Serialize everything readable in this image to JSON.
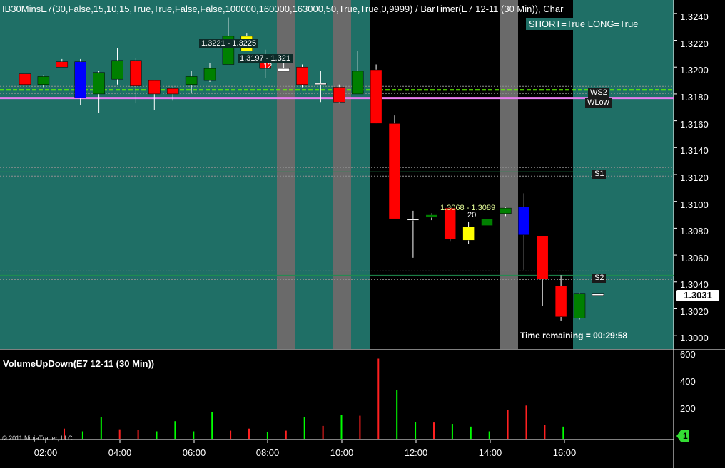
{
  "colors": {
    "chart_bg": "#1f6f66",
    "night_bg": "#000000",
    "session_bar": "#6a6a6a",
    "up": "#008000",
    "down": "#ff0000",
    "highlight_yellow": "#ffff00",
    "highlight_blue": "#0000ff",
    "pivot_pink": "#e87ef0",
    "pivot_green": "#66ff00",
    "grid_line": "#909090"
  },
  "header": {
    "title": "IB30MinsE7(30,False,15,10,15,True,True,False,False,100000,160000,163000,50,True,True,0,9999)  /  BarTimer(E7  12-11  (30  Min)),  Char",
    "bias": "SHORT=True LONG=True"
  },
  "timer": "Time remaining = 00:29:58",
  "levels": {
    "ws2": "WS2",
    "wlow": "WLow",
    "s1": "S1",
    "s2": "S2"
  },
  "annotations": {
    "range_top": "1.3221 - 1.3225",
    "range_top_b": "1.3197 - 1.321",
    "count_top": "12",
    "range_bottom": "1.3068 - 1.3089",
    "count_bottom": "20"
  },
  "price_axis": [
    "1.3240",
    "1.3220",
    "1.3200",
    "1.3180",
    "1.3160",
    "1.3140",
    "1.3120",
    "1.3100",
    "1.3080",
    "1.3060",
    "1.3040",
    "1.3020",
    "1.3000"
  ],
  "last_price": "1.3031",
  "volume_panel": {
    "title": "VolumeUpDown(E7 12-11 (30 Min))",
    "axis": [
      "600",
      "400",
      "200"
    ],
    "current_label": "1"
  },
  "time_axis": [
    "02:00",
    "04:00",
    "06:00",
    "08:00",
    "10:00",
    "12:00",
    "14:00",
    "16:00"
  ],
  "copyright": "© 2011 NinjaTrader, LLC",
  "chart_data": {
    "type": "candlestick",
    "bars": [
      {
        "o": 1.3195,
        "h": 1.3195,
        "l": 1.3187,
        "c": 1.3187
      },
      {
        "o": 1.3187,
        "h": 1.3194,
        "l": 1.3185,
        "c": 1.3193,
        "color": "up"
      },
      {
        "o": 1.3204,
        "h": 1.3206,
        "l": 1.32,
        "c": 1.32
      },
      {
        "o": 1.3204,
        "h": 1.3206,
        "l": 1.3172,
        "c": 1.3177,
        "color": "blue"
      },
      {
        "o": 1.318,
        "h": 1.3197,
        "l": 1.3166,
        "c": 1.3196,
        "color": "up"
      },
      {
        "o": 1.3191,
        "h": 1.3214,
        "l": 1.3187,
        "c": 1.3205,
        "color": "up"
      },
      {
        "o": 1.3205,
        "h": 1.3207,
        "l": 1.3173,
        "c": 1.3186
      },
      {
        "o": 1.319,
        "h": 1.319,
        "l": 1.3168,
        "c": 1.318
      },
      {
        "o": 1.318,
        "h": 1.3185,
        "l": 1.3175,
        "c": 1.3184
      },
      {
        "o": 1.3187,
        "h": 1.3197,
        "l": 1.3181,
        "c": 1.3193,
        "color": "up"
      },
      {
        "o": 1.319,
        "h": 1.3203,
        "l": 1.3189,
        "c": 1.3199,
        "color": "up"
      },
      {
        "o": 1.3202,
        "h": 1.3237,
        "l": 1.3202,
        "c": 1.3223,
        "color": "up"
      },
      {
        "o": 1.3223,
        "h": 1.3225,
        "l": 1.3212,
        "c": 1.3212,
        "color": "yellow"
      },
      {
        "o": 1.3209,
        "h": 1.3213,
        "l": 1.3192,
        "c": 1.3199
      },
      {
        "o": 1.3199,
        "h": 1.3203,
        "l": 1.3197,
        "c": 1.3197,
        "color": "white"
      },
      {
        "o": 1.32,
        "h": 1.3202,
        "l": 1.3185,
        "c": 1.3187
      },
      {
        "o": 1.3188,
        "h": 1.3197,
        "l": 1.3174,
        "c": 1.3188,
        "color": "white"
      },
      {
        "o": 1.3185,
        "h": 1.3187,
        "l": 1.3173,
        "c": 1.3174
      },
      {
        "o": 1.318,
        "h": 1.3212,
        "l": 1.318,
        "c": 1.3197,
        "color": "up"
      },
      {
        "o": 1.3198,
        "h": 1.3202,
        "l": 1.3158,
        "c": 1.3158
      },
      {
        "o": 1.3158,
        "h": 1.3164,
        "l": 1.3087,
        "c": 1.3087
      },
      {
        "o": 1.3087,
        "h": 1.3093,
        "l": 1.3058,
        "c": 1.3087,
        "color": "white"
      },
      {
        "o": 1.3088,
        "h": 1.3091,
        "l": 1.3086,
        "c": 1.309,
        "color": "up"
      },
      {
        "o": 1.3095,
        "h": 1.3095,
        "l": 1.307,
        "c": 1.3072
      },
      {
        "o": 1.3071,
        "h": 1.3085,
        "l": 1.3068,
        "c": 1.3081,
        "color": "yellow"
      },
      {
        "o": 1.3082,
        "h": 1.3089,
        "l": 1.3078,
        "c": 1.3087,
        "color": "up"
      },
      {
        "o": 1.3091,
        "h": 1.3096,
        "l": 1.3089,
        "c": 1.3095,
        "color": "up"
      },
      {
        "o": 1.3096,
        "h": 1.3106,
        "l": 1.3049,
        "c": 1.3075,
        "color": "blue"
      },
      {
        "o": 1.3074,
        "h": 1.3074,
        "l": 1.3022,
        "c": 1.3042
      },
      {
        "o": 1.3037,
        "h": 1.3045,
        "l": 1.3011,
        "c": 1.3014
      },
      {
        "o": 1.3013,
        "h": 1.3032,
        "l": 1.3012,
        "c": 1.3031,
        "color": "up"
      },
      {
        "o": 1.3031,
        "h": 1.3031,
        "l": 1.3031,
        "c": 1.3031,
        "color": "current"
      }
    ],
    "volume": [
      {
        "v": 75,
        "c": "down"
      },
      {
        "v": 55,
        "c": "up"
      },
      {
        "v": 160,
        "c": "up"
      },
      {
        "v": 70,
        "c": "down"
      },
      {
        "v": 65,
        "c": "down"
      },
      {
        "v": 55,
        "c": "up"
      },
      {
        "v": 130,
        "c": "up"
      },
      {
        "v": 55,
        "c": "up"
      },
      {
        "v": 195,
        "c": "up"
      },
      {
        "v": 60,
        "c": "down"
      },
      {
        "v": 75,
        "c": "down"
      },
      {
        "v": 50,
        "c": "up"
      },
      {
        "v": 60,
        "c": "down"
      },
      {
        "v": 160,
        "c": "up"
      },
      {
        "v": 95,
        "c": "down"
      },
      {
        "v": 175,
        "c": "up"
      },
      {
        "v": 170,
        "c": "down"
      },
      {
        "v": 590,
        "c": "down"
      },
      {
        "v": 360,
        "c": "up"
      },
      {
        "v": 125,
        "c": "up"
      },
      {
        "v": 120,
        "c": "down"
      },
      {
        "v": 110,
        "c": "up"
      },
      {
        "v": 90,
        "c": "up"
      },
      {
        "v": 55,
        "c": "up"
      },
      {
        "v": 215,
        "c": "down"
      },
      {
        "v": 245,
        "c": "down"
      },
      {
        "v": 100,
        "c": "down"
      },
      {
        "v": 90,
        "c": "up"
      }
    ],
    "price_ylim": [
      1.299,
      1.325
    ],
    "volume_ylim": [
      0,
      640
    ],
    "pivots": {
      "ws2": 1.3183,
      "wlow": 1.3177,
      "s1": 1.3122,
      "s2": 1.3045
    }
  }
}
